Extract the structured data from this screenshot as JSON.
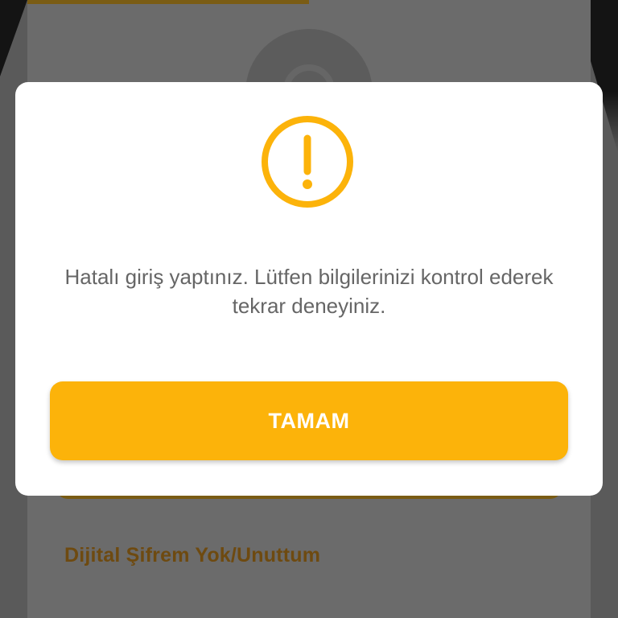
{
  "colors": {
    "accent": "#fcb30a",
    "overlay": "#666666",
    "dialog_background": "#ffffff",
    "message_text": "#666666"
  },
  "background": {
    "forgot_link": "Dijital Şifrem Yok/Unuttum"
  },
  "dialog": {
    "icon": "alert-circle-icon",
    "message": "Hatalı giriş yaptınız. Lütfen bilgilerinizi kontrol ederek tekrar deneyiniz.",
    "ok_label": "TAMAM"
  }
}
